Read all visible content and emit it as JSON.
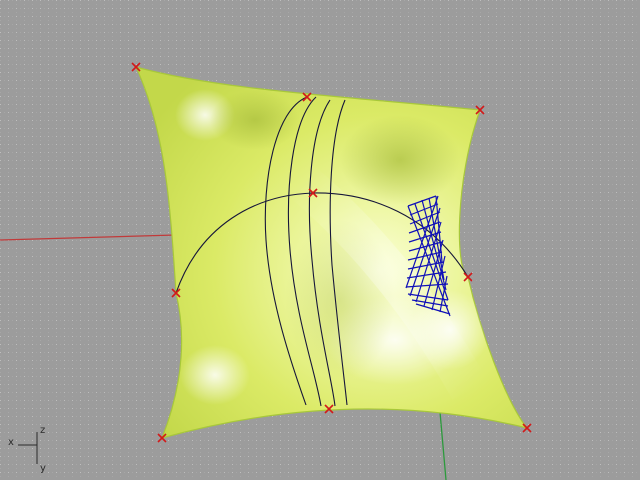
{
  "viewport": {
    "background_color": "#9c9c9c",
    "grid_color": "#b8b8b8",
    "grid_major_color": "#a9a9a9"
  },
  "axes": {
    "x_axis_color": "#c13a3a",
    "y_axis_color": "#2c9a3c",
    "indicator_labels": {
      "x": "x",
      "y": "y",
      "z": "z"
    }
  },
  "surface": {
    "fill_color": "#e3f06c",
    "highlight_color": "#fbffd4",
    "shadow_color": "#b7c94a",
    "edge_color": "#a8c83a"
  },
  "isocurves": {
    "color": "#16163a",
    "count": 4
  },
  "control_points": {
    "marker_color": "#d21a1a",
    "marker_icon": "x-mark-icon",
    "count": 9
  },
  "selected_points": {
    "color": "#1010b8",
    "icon": "point-cloud-icon"
  }
}
